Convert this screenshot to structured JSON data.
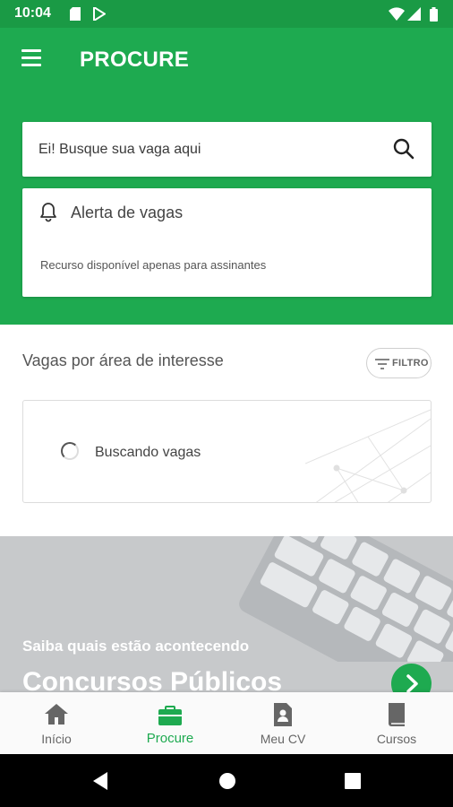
{
  "status_bar": {
    "time": "10:04"
  },
  "app_bar": {
    "title": "PROCURE"
  },
  "search": {
    "placeholder": "Ei! Busque sua vaga aqui"
  },
  "alert": {
    "title": "Alerta de vagas",
    "subtitle": "Recurso disponível apenas para assinantes"
  },
  "interest": {
    "title": "Vagas por área de interesse",
    "filter_label": "FILTRO",
    "loading_text": "Buscando vagas"
  },
  "banner": {
    "subtitle": "Saiba quais estão acontecendo",
    "title": "Concursos Públicos"
  },
  "bottom_nav": {
    "items": [
      {
        "label": "Início",
        "icon": "home-icon",
        "active": false
      },
      {
        "label": "Procure",
        "icon": "briefcase-icon",
        "active": true
      },
      {
        "label": "Meu CV",
        "icon": "cv-icon",
        "active": false
      },
      {
        "label": "Cursos",
        "icon": "book-icon",
        "active": false
      }
    ]
  },
  "colors": {
    "primary": "#1eaa50",
    "status_bar": "#1a9a45",
    "inactive": "#666666"
  }
}
